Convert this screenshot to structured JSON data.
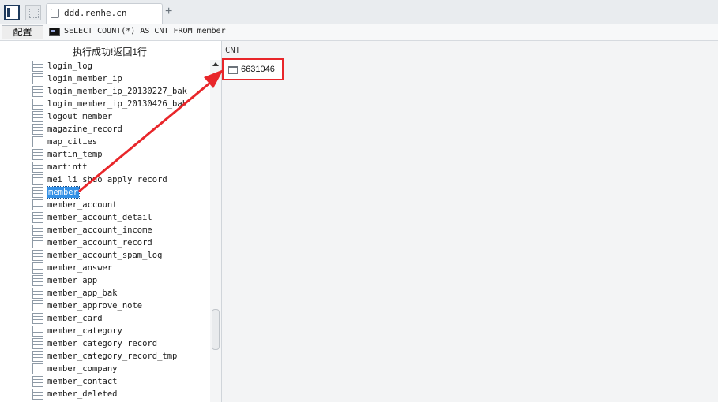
{
  "tabbar": {
    "tab_title": "ddd.renhe.cn",
    "add_symbol": "+"
  },
  "query": {
    "config_label": "配置",
    "sql": "SELECT COUNT(*) AS CNT FROM member"
  },
  "left_panel": {
    "status": "执行成功!返回1行",
    "tables": [
      "login_log",
      "login_member_ip",
      "login_member_ip_20130227_bak",
      "login_member_ip_20130426_bak",
      "logout_member",
      "magazine_record",
      "map_cities",
      "martin_temp",
      "martintt",
      "mei_li_shuo_apply_record",
      "member",
      "member_account",
      "member_account_detail",
      "member_account_income",
      "member_account_record",
      "member_account_spam_log",
      "member_answer",
      "member_app",
      "member_app_bak",
      "member_approve_note",
      "member_card",
      "member_category",
      "member_category_record",
      "member_category_record_tmp",
      "member_company",
      "member_contact",
      "member_deleted"
    ],
    "selected_table": "member"
  },
  "result": {
    "column": "CNT",
    "value": "6631046"
  },
  "colors": {
    "selection": "#3390e6",
    "annotation_red": "#e8262a"
  },
  "icons": [
    "panel-toggle-icon",
    "grid-icon",
    "tab-page-icon",
    "terminal-icon",
    "table-icon",
    "row-icon",
    "scroll-up-icon"
  ]
}
